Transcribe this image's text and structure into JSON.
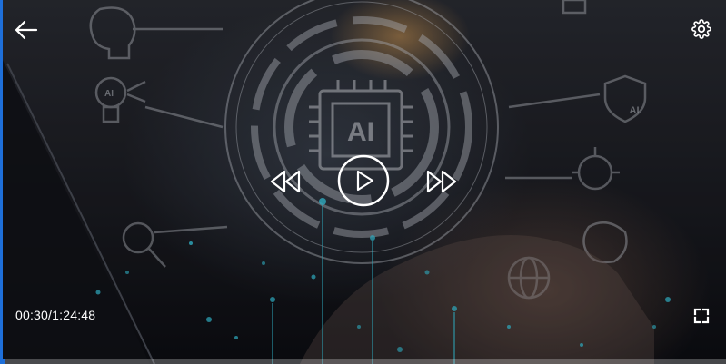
{
  "player": {
    "elapsed": "00:30",
    "separator": "/",
    "duration": "1:24:48",
    "progress_fraction": 0.006
  },
  "background": {
    "chip_label": "AI",
    "bulb_label": "AI",
    "shield_label": "AI"
  },
  "icons": {
    "back": "arrow-left-icon",
    "settings": "gear-icon",
    "rewind": "rewind-icon",
    "play": "play-icon",
    "fast_forward": "fast-forward-icon",
    "fullscreen": "fullscreen-icon"
  },
  "colors": {
    "accent": "#1e6fd9",
    "control": "#ffffff"
  }
}
